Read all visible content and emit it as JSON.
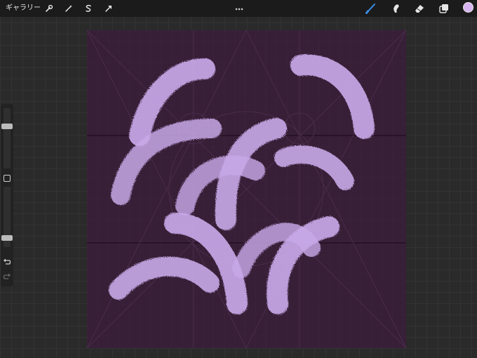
{
  "topbar": {
    "gallery_label": "ギャラリー",
    "more_icon": "more-dots-icon",
    "left_tools": [
      "wrench-icon",
      "magic-wand-icon",
      "selection-s-icon",
      "transform-arrow-icon"
    ],
    "right_tools": [
      "brush-icon",
      "smudge-icon",
      "eraser-icon",
      "layers-icon"
    ],
    "active_tool": "brush-icon",
    "accent_color": "#3c8fe6",
    "current_color": "#d8b4f0"
  },
  "sidebar": {
    "brush_size_level": 0.72,
    "opacity_level": 0.12,
    "icons": [
      "square-modify-icon",
      "undo-icon",
      "redo-icon"
    ]
  },
  "canvas": {
    "background_color": "#371f37",
    "stroke_color": "#c8a8e8",
    "grid_color": "#5a3a5a",
    "guide_color": "#4e2e4e"
  }
}
